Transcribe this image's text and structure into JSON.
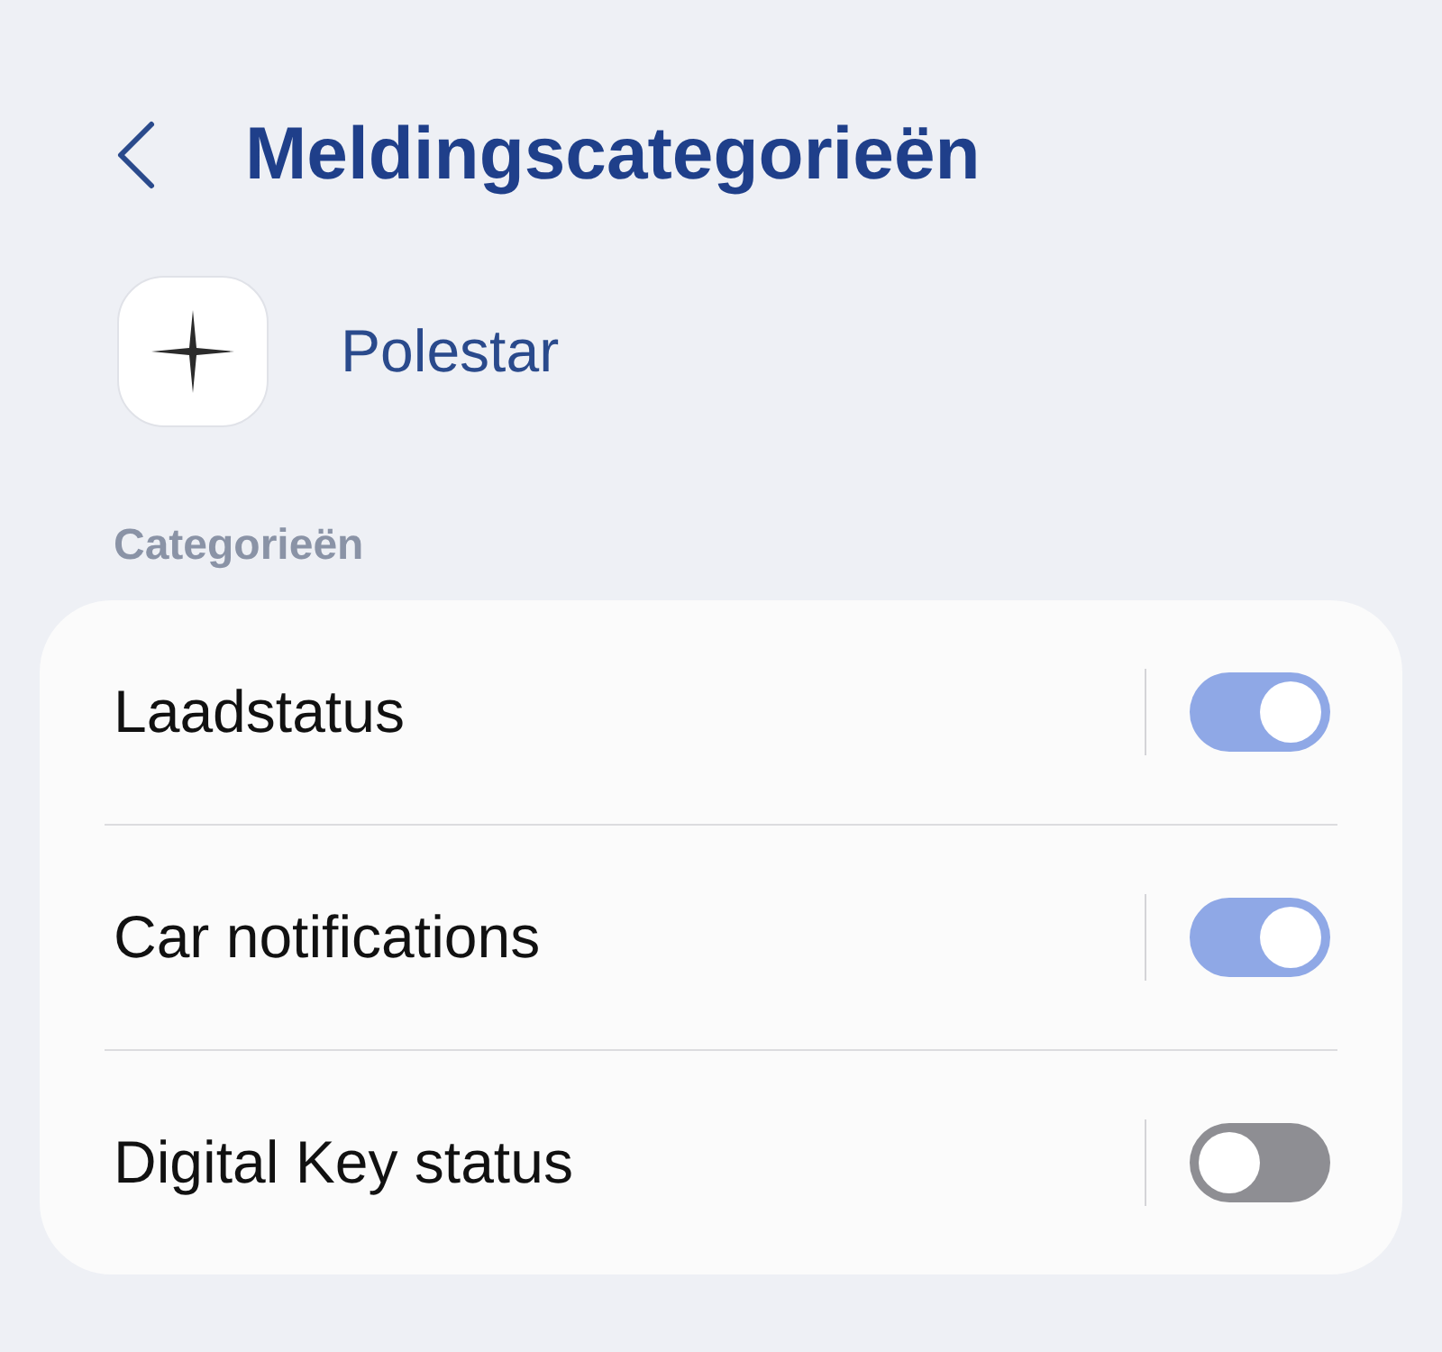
{
  "header": {
    "title": "Meldingscategorieën"
  },
  "app": {
    "name": "Polestar"
  },
  "section": {
    "label": "Categorieën"
  },
  "categories": [
    {
      "name": "Laadstatus",
      "on": true
    },
    {
      "name": "Car notifications",
      "on": true
    },
    {
      "name": "Digital Key status",
      "on": false
    }
  ]
}
